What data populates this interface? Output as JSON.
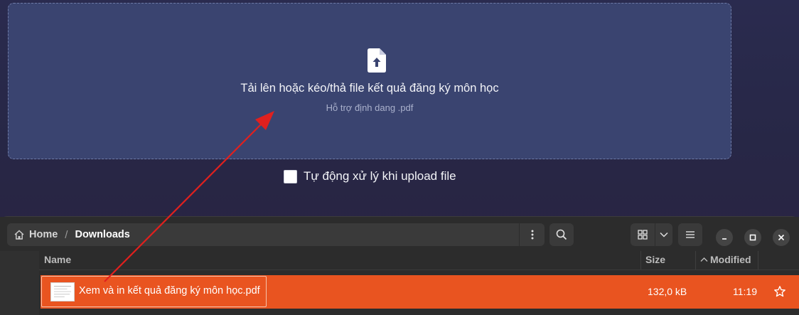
{
  "upload": {
    "icon": "file-upload-icon",
    "title": "Tải lên hoặc kéo/thả file kết quả đăng ký môn học",
    "subtitle": "Hỗ trợ định dang .pdf"
  },
  "auto_process": {
    "label": "Tự động xử lý khi upload file",
    "checked": false
  },
  "file_manager": {
    "breadcrumb": {
      "home": "Home",
      "separator": "/",
      "current": "Downloads"
    },
    "columns": {
      "name": "Name",
      "size": "Size",
      "modified": "Modified"
    },
    "files": [
      {
        "name": "Xem và in kết quả đăng ký môn học.pdf",
        "size": "132,0 kB",
        "modified": "11:19",
        "selected": true
      }
    ],
    "icons": [
      "home-icon",
      "menu-icon",
      "search-icon",
      "grid-view-icon",
      "chevron-down-icon",
      "list-view-icon",
      "minimize-icon",
      "maximize-icon",
      "close-icon",
      "star-icon"
    ]
  },
  "colors": {
    "accent": "#e95420",
    "dropzone_bg": "#3a4470",
    "drag_arrow": "#e0201e"
  }
}
